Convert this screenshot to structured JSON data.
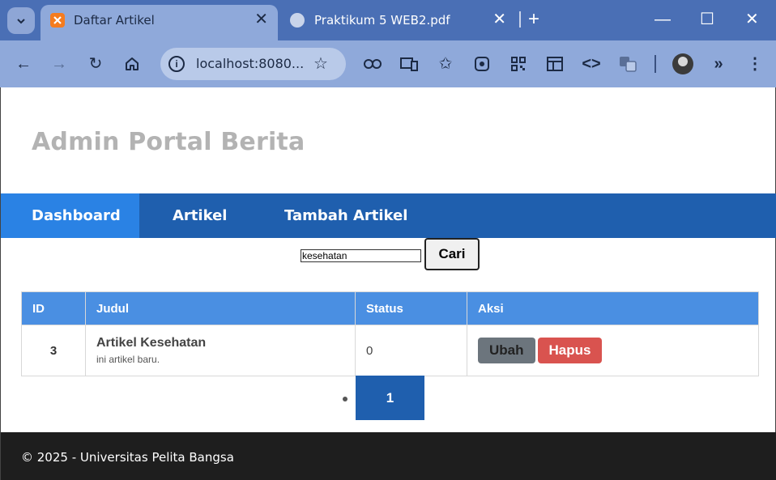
{
  "browser": {
    "tabs": [
      {
        "title": "Daftar Artikel",
        "active": true,
        "icon": "xampp-icon"
      },
      {
        "title": "Praktikum 5 WEB2.pdf",
        "active": false,
        "icon": "globe-icon"
      }
    ],
    "address": "localhost:8080..."
  },
  "site": {
    "title": "Admin Portal Berita"
  },
  "nav": {
    "items": [
      {
        "label": "Dashboard",
        "active": true
      },
      {
        "label": "Artikel",
        "active": false
      },
      {
        "label": "Tambah Artikel",
        "active": false
      }
    ]
  },
  "search": {
    "value": "kesehatan",
    "button_label": "Cari"
  },
  "table": {
    "headers": [
      "ID",
      "Judul",
      "Status",
      "Aksi"
    ],
    "rows": [
      {
        "id": "3",
        "title": "Artikel Kesehatan",
        "description": "ini artikel baru.",
        "status": "0",
        "actions": {
          "edit": "Ubah",
          "delete": "Hapus"
        }
      }
    ]
  },
  "pagination": {
    "current": "1"
  },
  "footer": {
    "text": "© 2025 - Universitas Pelita Bangsa"
  },
  "colors": {
    "nav_bg": "#1f5fae",
    "nav_active": "#2a82e4",
    "table_header": "#4a8fe2",
    "delete_btn": "#d9534f",
    "edit_btn": "#6c757d",
    "footer_bg": "#1e1e1e"
  }
}
